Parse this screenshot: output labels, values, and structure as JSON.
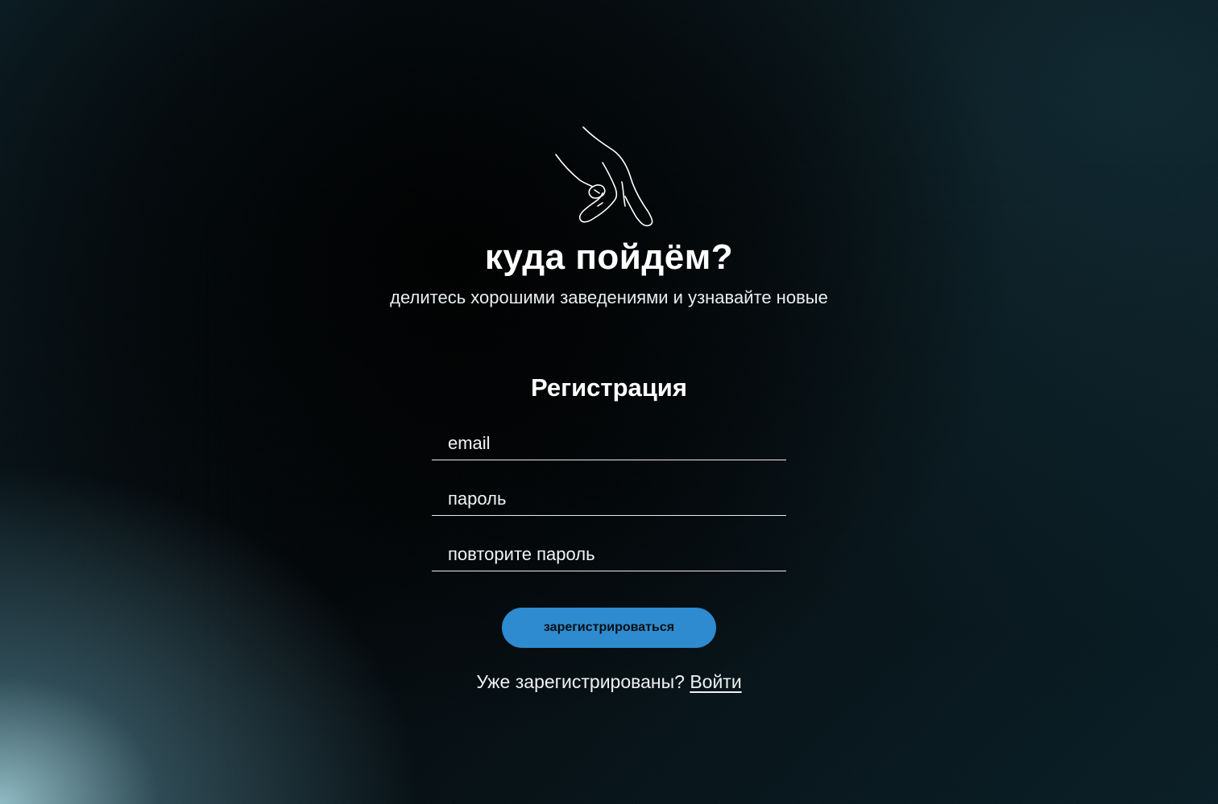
{
  "hero": {
    "icon": "pointing-hand-icon",
    "title": "куда пойдём?",
    "tagline": "делитесь хорошими заведениями и узнавайте новые"
  },
  "registration": {
    "heading": "Регистрация",
    "email_placeholder": "email",
    "password_placeholder": "пароль",
    "repeat_password_placeholder": "повторите пароль",
    "submit_label": "зарегистрироваться",
    "login_prompt": "Уже зарегистрированы?",
    "login_link": "Войти"
  },
  "colors": {
    "accent": "#2e8bcf",
    "text": "#ffffff",
    "background_dark": "#061820",
    "glow": "#96c3cd"
  }
}
